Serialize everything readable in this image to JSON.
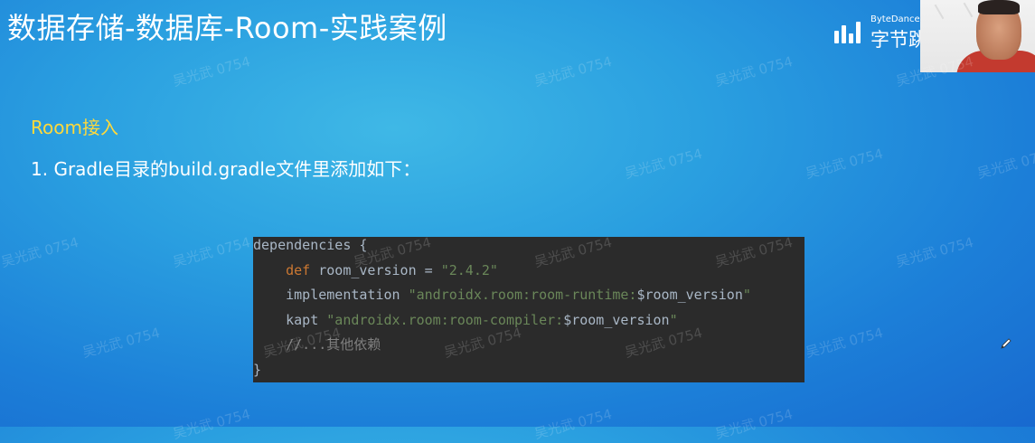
{
  "slide": {
    "title": "数据存储-数据库-Room-实践案例",
    "section_heading": "Room接入",
    "step_text": "1. Gradle目录的build.gradle文件里添加如下："
  },
  "brand": {
    "top_text": "ByteDance",
    "bottom_text": "字节跳"
  },
  "code": {
    "line1": "dependencies {",
    "line2_indent": "    ",
    "line2_kw": "def",
    "line2_rest": " room_version = ",
    "line2_str": "\"2.4.2\"",
    "line3_pre": "    implementation ",
    "line3_str": "\"androidx.room:room-runtime:",
    "line3_var": "$room_version",
    "line3_end": "\"",
    "line4_pre": "    kapt ",
    "line4_str": "\"androidx.room:room-compiler:",
    "line4_var": "$room_version",
    "line4_end": "\"",
    "line5": "    //...其他依赖",
    "line6": "}"
  },
  "watermark": {
    "text": "吴光武 0754"
  },
  "colors": {
    "background": "#2a9fe0",
    "title": "#ffffff",
    "section_heading": "#ffd93b",
    "code_bg": "#2b2b2b",
    "code_keyword": "#cc7832",
    "code_string": "#6a8759",
    "code_text": "#a9b7c6"
  },
  "icons": {
    "brand_logo": "bytedance-bars-logo",
    "pen": "pen-icon"
  }
}
